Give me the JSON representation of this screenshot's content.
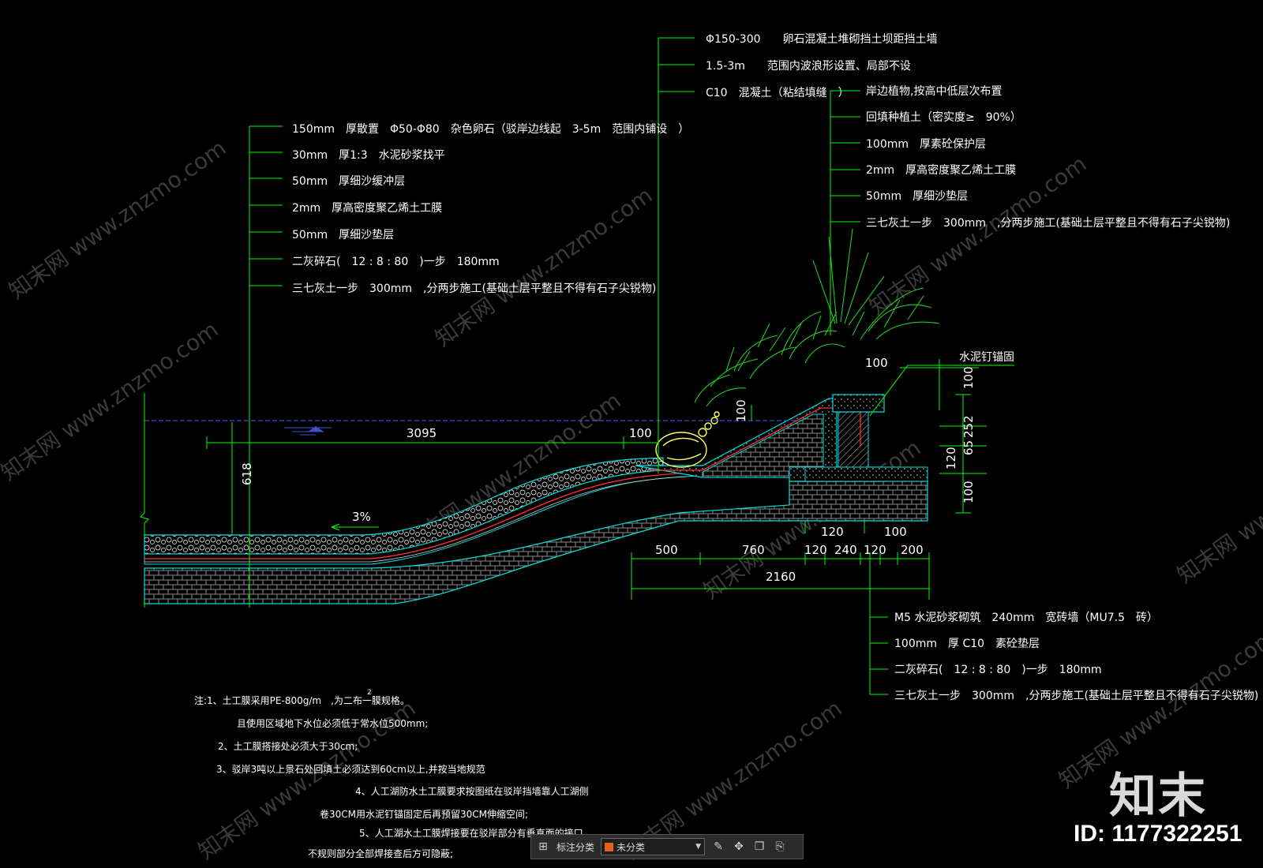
{
  "top_notes": [
    "Φ150-300　　卵石混凝土堆砌挡土坝距挡土墙",
    "1.5-3m　　范围内波浪形设置、局部不设",
    "C10　混凝土（粘结填缝　）"
  ],
  "left_layers": [
    "150mm　厚散置　Φ50-Φ80　杂色卵石（驳岸边线起　3-5m　范围内铺设　）",
    "30mm　厚1:3　水泥砂浆找平",
    "50mm　厚细沙缓冲层",
    "2mm　厚高密度聚乙烯土工膜",
    "50mm　厚细沙垫层",
    "二灰碎石(　12 : 8 : 80　)一步　180mm",
    "三七灰土一步　300mm　,分两步施工(基础土层平整且不得有石子尖锐物)"
  ],
  "right_layers": [
    "岸边植物,按高中低层次布置",
    "回填种植土（密实度≥　90%）",
    "100mm　厚素砼保护层",
    "2mm　厚高密度聚乙烯土工膜",
    "50mm　厚细沙垫层",
    "三七灰土一步　300mm　,分两步施工(基础土层平整且不得有石子尖锐物)"
  ],
  "anchor_label": "水泥钉锚固",
  "bottom_right_layers": [
    "M5 水泥砂浆砌筑　240mm　宽砖墙（MU7.5　砖）",
    "100mm　厚 C10　素砼垫层",
    "二灰碎石(　12 : 8 : 80　)一步　180mm",
    "三七灰土一步　300mm　,分两步施工(基础土层平整且不得有石子尖锐物)"
  ],
  "dimensions": {
    "d3095": "3095",
    "d100_left": "100",
    "d618": "618",
    "slope": "3%",
    "d100_mid": "100",
    "d100_top": "100",
    "r100a": "100",
    "r252": "252",
    "r65": "65",
    "r120": "120",
    "r100b": "100",
    "b120a": "120",
    "b100": "100",
    "b500": "500",
    "b760": "760",
    "b120b": "120",
    "b240": "240",
    "b120c": "120",
    "b200": "200",
    "b2160": "2160"
  },
  "notes": [
    "注:1、土工膜采用PE-800g/m　,为二布一膜规格。",
    "且使用区域地下水位必须低于常水位500mm;",
    "2、土工膜搭接处必须大于30cm;",
    "3、驳岸3吨以上景石处回填土必须达到60cm以上,并按当地规范",
    "4、人工湖防水土工膜要求按图纸在驳岸挡墙靠人工湖侧",
    "卷30CM用水泥钉锚固定后再预留30CM伸缩空间;",
    "5、人工湖水土工膜焊接要在驳岸部分有垂直面的接口,",
    "不规则部分全部焊接查后方可隐蔽;"
  ],
  "note_superscript": "2",
  "watermark": "知末网 www.znzmo.com",
  "logo_text": "知末",
  "id_text": "ID: 1177322251",
  "toolbar": {
    "label": "标注分类",
    "select_value": "未分类",
    "swatch_color": "#e8601c"
  },
  "colors": {
    "leader": "#00ff00",
    "text": "#ffffff",
    "water": "#3b4fc8",
    "plants": "#22cc22",
    "outline": "#00e0e0",
    "membrane": "#ff3030",
    "stones": "#ffff66"
  }
}
